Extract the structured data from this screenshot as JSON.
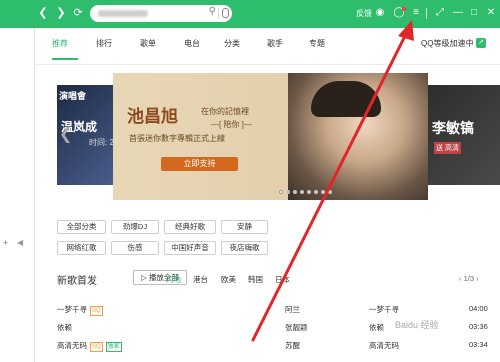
{
  "titlebar": {
    "nav": {
      "back_icon": "chevron-left",
      "forward_icon": "chevron-right",
      "refresh_icon": "refresh"
    },
    "search": {
      "icon": "search-icon",
      "mic": "mic-icon"
    },
    "feedback": "反馈",
    "icons": [
      "wifi-icon",
      "skin-icon",
      "mail-icon",
      "menu-icon",
      "mini-mode-icon",
      "minimize-icon",
      "maximize-icon",
      "close-icon"
    ]
  },
  "tabs": [
    "推荐",
    "排行",
    "歌单",
    "电台",
    "分类",
    "歌手",
    "专题"
  ],
  "active_tab": "推荐",
  "vip_text": "QQ等级加速中",
  "banner": {
    "title": "池昌旭",
    "line1": "在你的記憶裡",
    "line2": "—[ 陪你 ]—",
    "line3": "首張迷你數字專輯正式上線",
    "button": "立即支持",
    "dots": 8,
    "active_dot": 0
  },
  "side_left": {
    "title": "演唱會",
    "text": "温岚成",
    "time": "时间: 2"
  },
  "side_right": {
    "title": "李敏镐",
    "sub": "送 高清"
  },
  "categories": [
    [
      "全部分类",
      "劲爆DJ",
      "经典好歌",
      "安静"
    ],
    [
      "网络红歌",
      "伤感",
      "中国好声音",
      "夜店嗨歌"
    ]
  ],
  "new_songs": {
    "title": "新歌首发",
    "play_all": "播放全部",
    "regions": [
      "内地",
      "港台",
      "欧美",
      "韩国",
      "日本"
    ],
    "active_region": "内地",
    "pager": "1/3",
    "rows": [
      {
        "left": "一梦千寻",
        "left_badge": "SQ",
        "mid": "阿兰",
        "right": "一梦千寻",
        "dur": "04:00"
      },
      {
        "left": "依赖",
        "mid": "张靓颖",
        "right": "依赖",
        "dur": "03:36"
      },
      {
        "left": "高清无码",
        "left_badge": "SQ",
        "left_badge2": "独家",
        "mid": "苏醒",
        "right": "高清无码",
        "dur": "03:34"
      }
    ]
  },
  "watermark": "Baidu 经验",
  "colors": {
    "brand_green": "#2ebd6c",
    "annotation_red": "#e0262a"
  }
}
